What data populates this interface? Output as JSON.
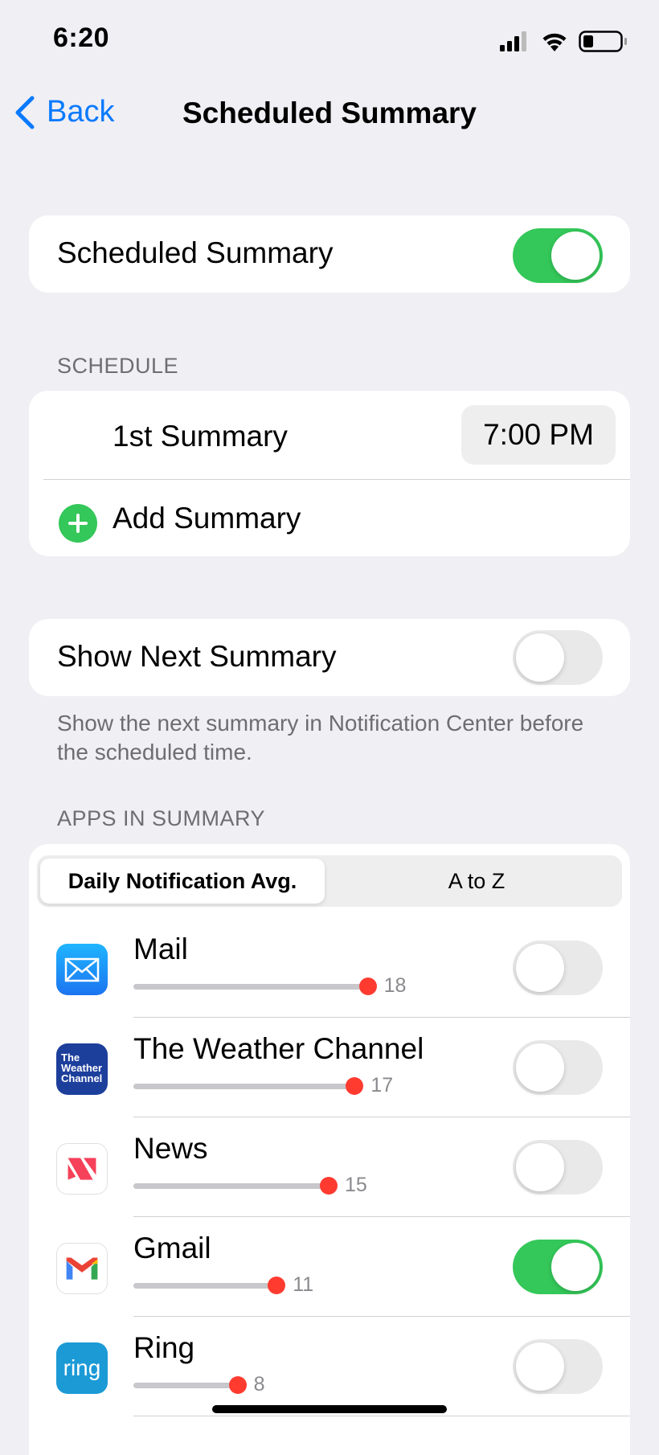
{
  "status_bar": {
    "time": "6:20"
  },
  "nav": {
    "back_label": "Back",
    "title": "Scheduled Summary"
  },
  "main_toggle": {
    "label": "Scheduled Summary",
    "on": true
  },
  "schedule": {
    "header": "SCHEDULE",
    "summaries": [
      {
        "label": "1st Summary",
        "time": "7:00 PM"
      }
    ],
    "add_label": "Add Summary"
  },
  "next_summary": {
    "label": "Show Next Summary",
    "on": false,
    "footnote": "Show the next summary in Notification Center before the scheduled time."
  },
  "apps_section": {
    "header": "APPS IN SUMMARY",
    "segments": [
      "Daily Notification Avg.",
      "A to Z"
    ],
    "selected_segment": 0,
    "apps": [
      {
        "name": "Mail",
        "avg": 18,
        "on": false,
        "icon": "mail-icon"
      },
      {
        "name": "The Weather Channel",
        "avg": 17,
        "on": false,
        "icon": "weather-channel-icon",
        "icon_text": "The Weather Channel"
      },
      {
        "name": "News",
        "avg": 15,
        "on": false,
        "icon": "news-icon"
      },
      {
        "name": "Gmail",
        "avg": 11,
        "on": true,
        "icon": "gmail-icon"
      },
      {
        "name": "Ring",
        "avg": 8,
        "on": false,
        "icon": "ring-icon",
        "icon_text": "ring"
      }
    ]
  },
  "colors": {
    "accent": "#0a7aff",
    "toggle_on": "#34c759",
    "dot": "#ff3b30"
  }
}
